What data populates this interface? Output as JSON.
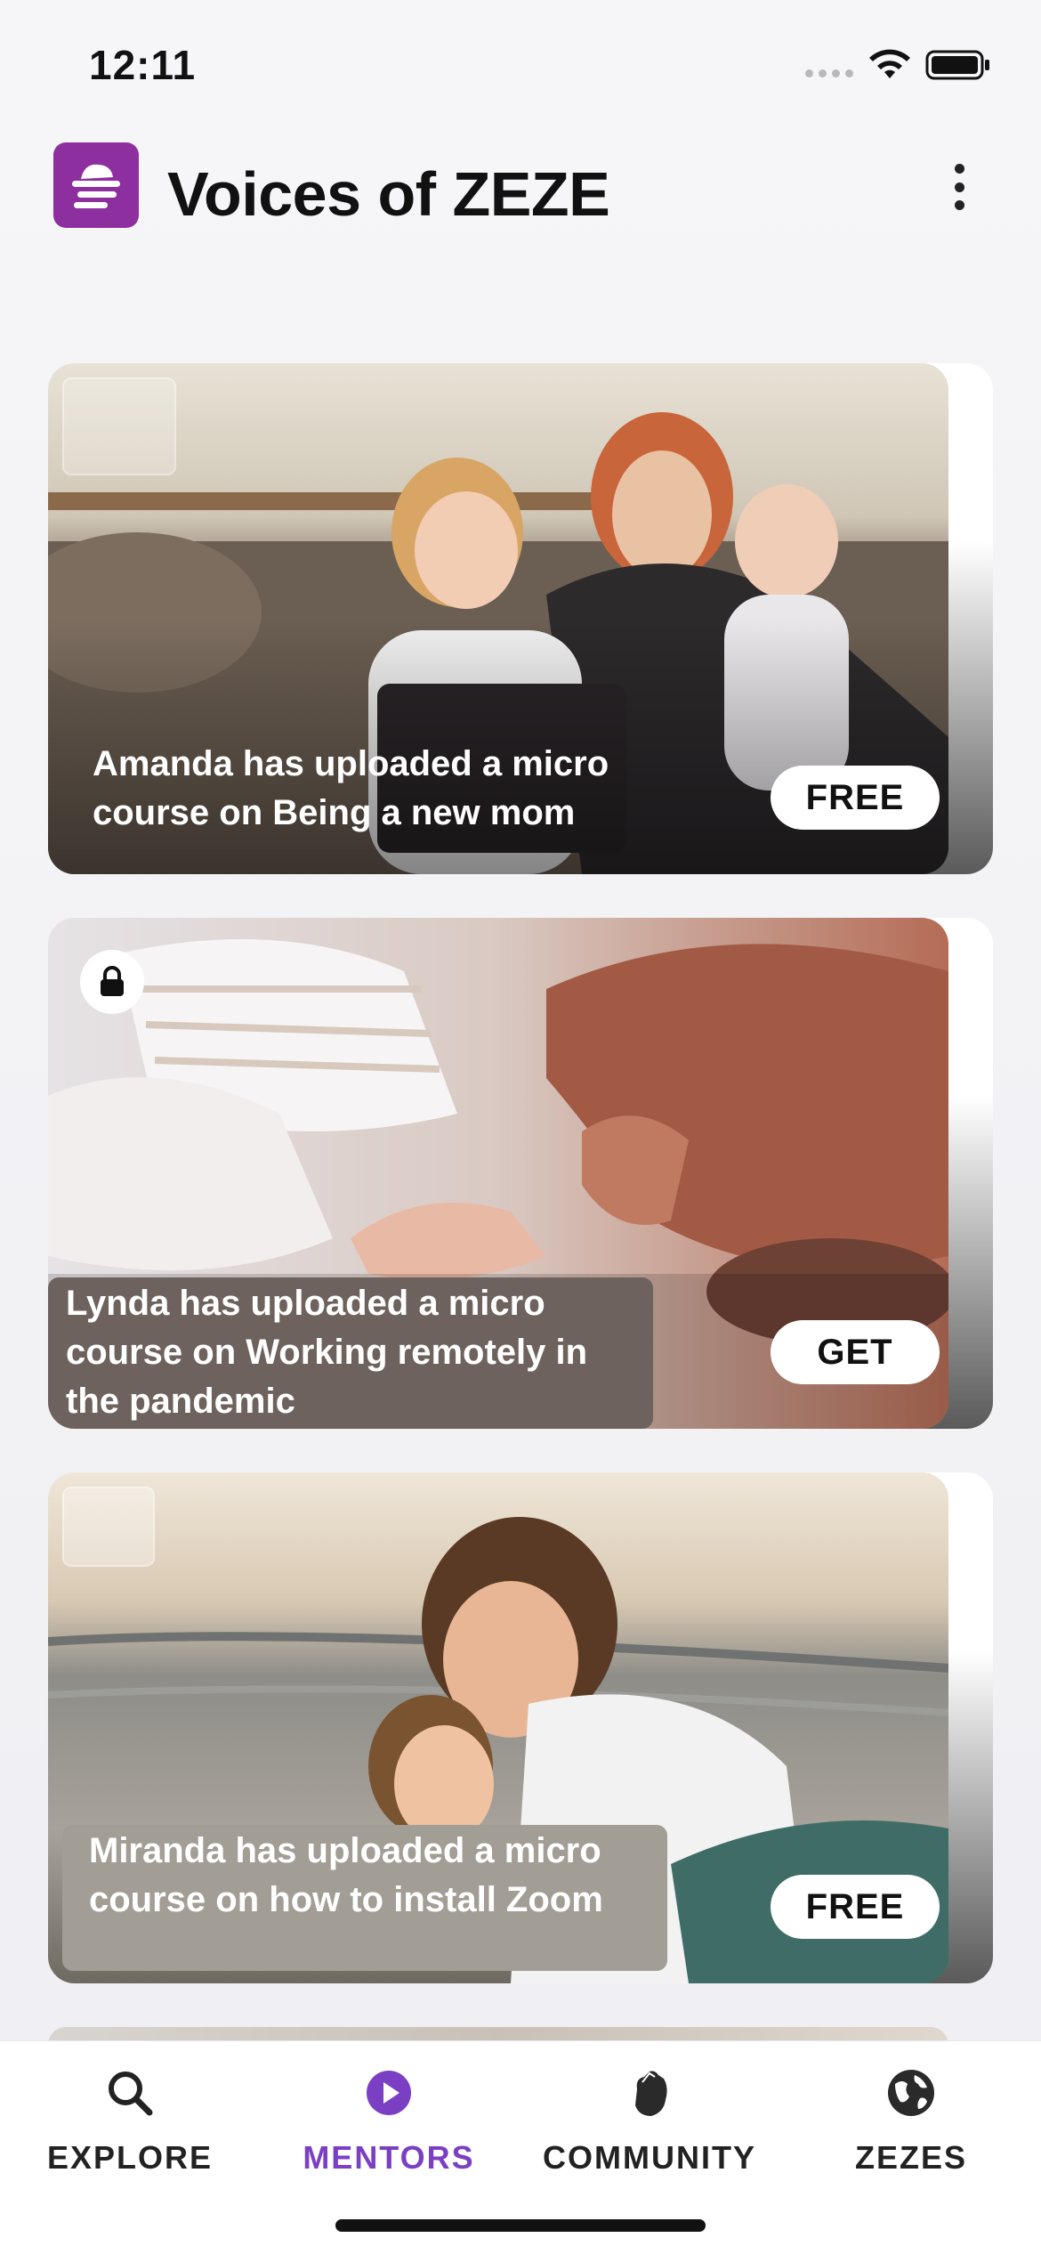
{
  "status_bar": {
    "time": "12:11"
  },
  "header": {
    "title": "Voices of ZEZE"
  },
  "feed": {
    "cards": [
      {
        "text": "Amanda has uploaded a micro course on Being a new mom",
        "price": "FREE"
      },
      {
        "text": "Lynda has uploaded a micro course on Working remotely in the pandemic",
        "price": "GET"
      },
      {
        "text": "Miranda has uploaded a micro course on how to install Zoom",
        "price": "FREE"
      }
    ]
  },
  "nav": {
    "items": [
      {
        "label": "EXPLORE",
        "icon": "search-icon"
      },
      {
        "label": "MENTORS",
        "icon": "play-circle-icon"
      },
      {
        "label": "COMMUNITY",
        "icon": "fist-icon"
      },
      {
        "label": "ZEZES",
        "icon": "globe-icon"
      }
    ],
    "active_color": "#7b3fc4"
  },
  "colors": {
    "brand": "#8e2fa0"
  }
}
